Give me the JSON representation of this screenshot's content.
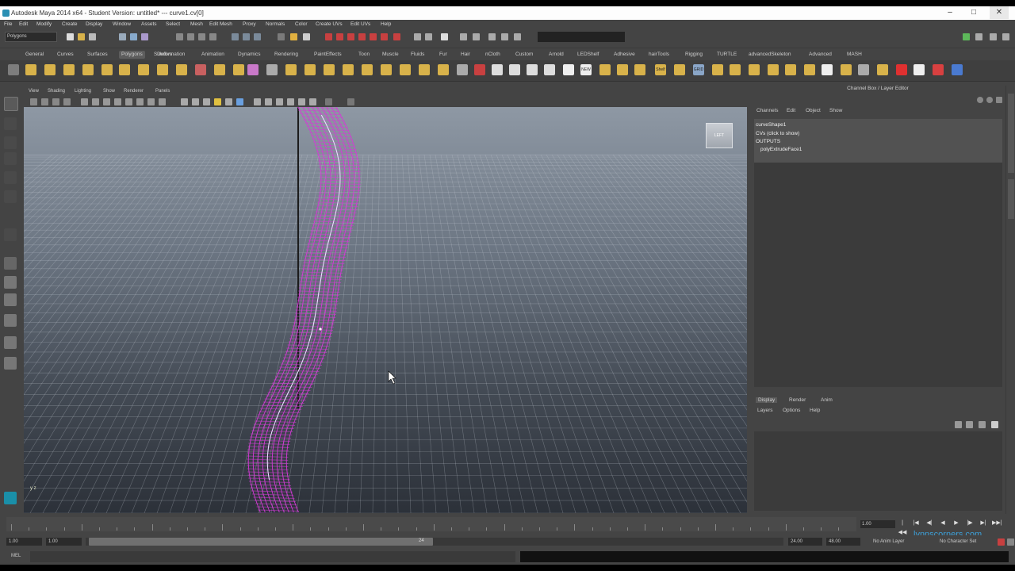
{
  "window": {
    "title": "Autodesk Maya 2014 x64 - Student Version: untitled* --- curve1.cv[0]",
    "controls": [
      "–",
      "□",
      "✕"
    ]
  },
  "menubar": {
    "items": [
      "File",
      "Edit",
      "Modify",
      "Create",
      "Display",
      "Window",
      "Assets",
      "Select",
      "Mesh",
      "Edit Mesh",
      "Proxy",
      "Normals",
      "Color",
      "Create UVs",
      "Edit UVs",
      "Help"
    ]
  },
  "statusline": {
    "menuset": "Polygons"
  },
  "shelf": {
    "tabs": [
      "General",
      "Curves",
      "Surfaces",
      "Polygons",
      "Subdivs",
      "Deformation",
      "Animation",
      "Dynamics",
      "Rendering",
      "PaintEffects",
      "Toon",
      "Muscle",
      "Fluids",
      "Fur",
      "Hair",
      "nCloth",
      "Custom",
      "Arnold",
      "LEDShelf",
      "Adhesive",
      "hairTools",
      "Rigging",
      "TURTLE",
      "advancedSkeleton",
      "Advanced",
      "MASH"
    ],
    "active_tab": "Polygons",
    "icon_labels": [
      "NEW",
      "Shelf",
      "GRID"
    ]
  },
  "viewport": {
    "menus": [
      "View",
      "Shading",
      "Lighting",
      "Show",
      "Renderer",
      "Panels"
    ],
    "viewcube_label": "LEFT",
    "axis_label": "y z",
    "accent_color": "#d43ad6"
  },
  "channel_box": {
    "title": "Channel Box / Layer Editor",
    "menus": [
      "Channels",
      "Edit",
      "Object",
      "Show"
    ],
    "lines": [
      "curveShape1",
      "CVs (click to show)",
      "OUTPUTS",
      "polyExtrudeFace1"
    ],
    "layer_tabs": [
      "Display",
      "Render",
      "Anim"
    ],
    "layer_menus": [
      "Layers",
      "Options",
      "Help"
    ]
  },
  "timeline": {
    "current_frame": "1.00",
    "playback_buttons": [
      "|◀◀",
      "|◀",
      "◀|",
      "◀",
      "▶",
      "|▶",
      "▶|",
      "▶▶|"
    ]
  },
  "range": {
    "start": "1.00",
    "playback_start": "1.00",
    "handle_label": "24",
    "playback_end": "24.00",
    "end": "48.00",
    "anim_layer": "No Anim Layer",
    "char_set": "No Character Set"
  },
  "command_line": {
    "label": "MEL"
  },
  "watermark": "lynnscorners.com"
}
